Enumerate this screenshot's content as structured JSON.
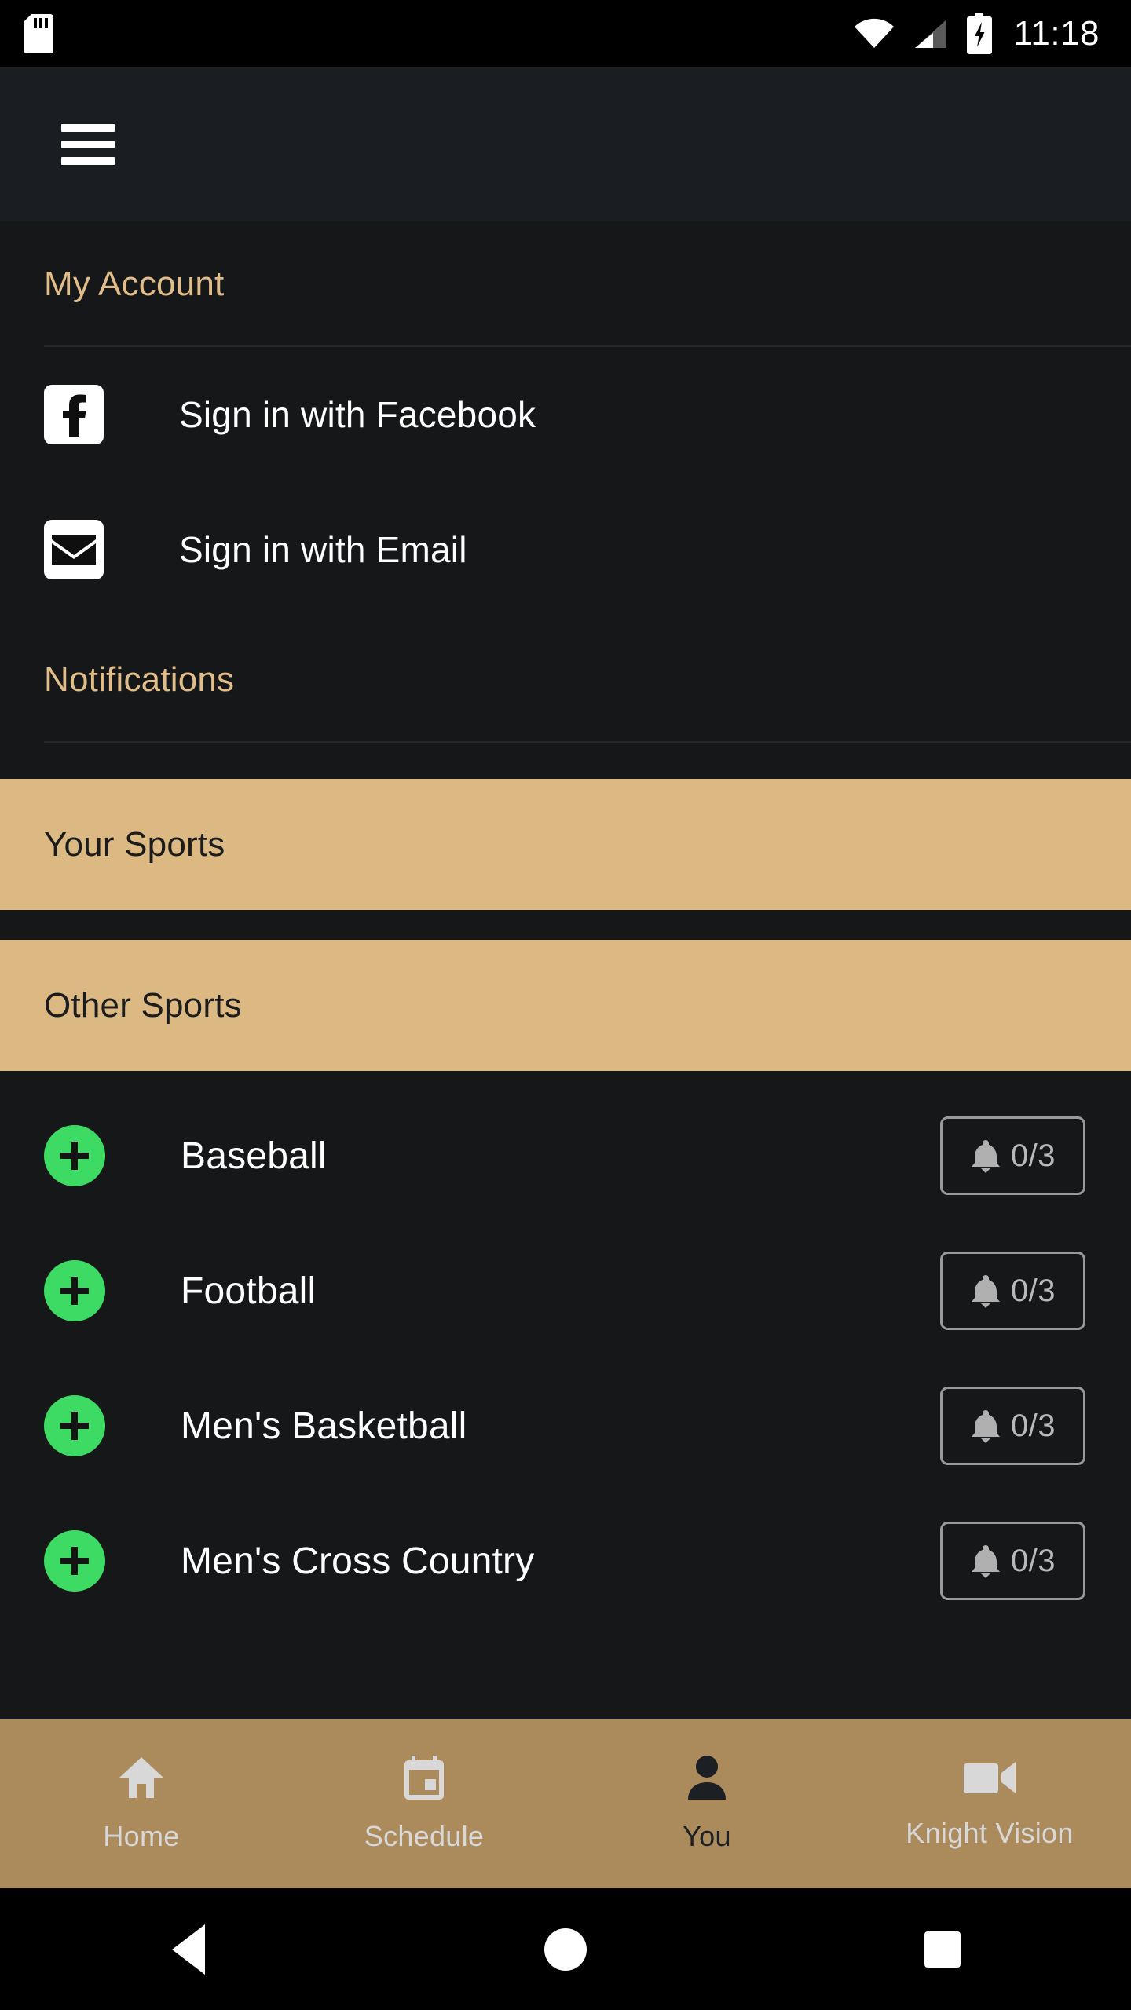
{
  "status_bar": {
    "sd_card_icon": "sd-card-icon",
    "wifi_icon": "wifi-icon",
    "signal_icon": "cellular-signal-icon",
    "battery_icon": "battery-charging-icon",
    "time": "11:18"
  },
  "app_bar": {
    "menu_icon": "hamburger-menu-icon"
  },
  "sections": {
    "my_account": {
      "title": "My Account",
      "items": [
        {
          "icon": "facebook-icon",
          "label": "Sign in with Facebook"
        },
        {
          "icon": "email-icon",
          "label": "Sign in with Email"
        }
      ]
    },
    "notifications": {
      "title": "Notifications",
      "your_sports_label": "Your Sports",
      "other_sports_label": "Other Sports"
    }
  },
  "sports": [
    {
      "name": "Baseball",
      "add_icon": "plus-icon",
      "bell_icon": "bell-icon",
      "count": "0/3"
    },
    {
      "name": "Football",
      "add_icon": "plus-icon",
      "bell_icon": "bell-icon",
      "count": "0/3"
    },
    {
      "name": "Men's Basketball",
      "add_icon": "plus-icon",
      "bell_icon": "bell-icon",
      "count": "0/3"
    },
    {
      "name": "Men's Cross Country",
      "add_icon": "plus-icon",
      "bell_icon": "bell-icon",
      "count": "0/3"
    }
  ],
  "bottom_nav": [
    {
      "label": "Home",
      "icon": "home-icon",
      "active": false
    },
    {
      "label": "Schedule",
      "icon": "calendar-icon",
      "active": false
    },
    {
      "label": "You",
      "icon": "person-icon",
      "active": true
    },
    {
      "label": "Knight Vision",
      "icon": "video-camera-icon",
      "active": false
    }
  ],
  "android_nav": {
    "back": "back-triangle-icon",
    "home": "home-circle-icon",
    "recents": "recents-square-icon"
  },
  "colors": {
    "accent_tan": "#dcb982",
    "nav_bronze": "#ab8a5c",
    "add_green": "#3ddb63",
    "background": "#161719",
    "app_bar": "#1a1d21"
  }
}
